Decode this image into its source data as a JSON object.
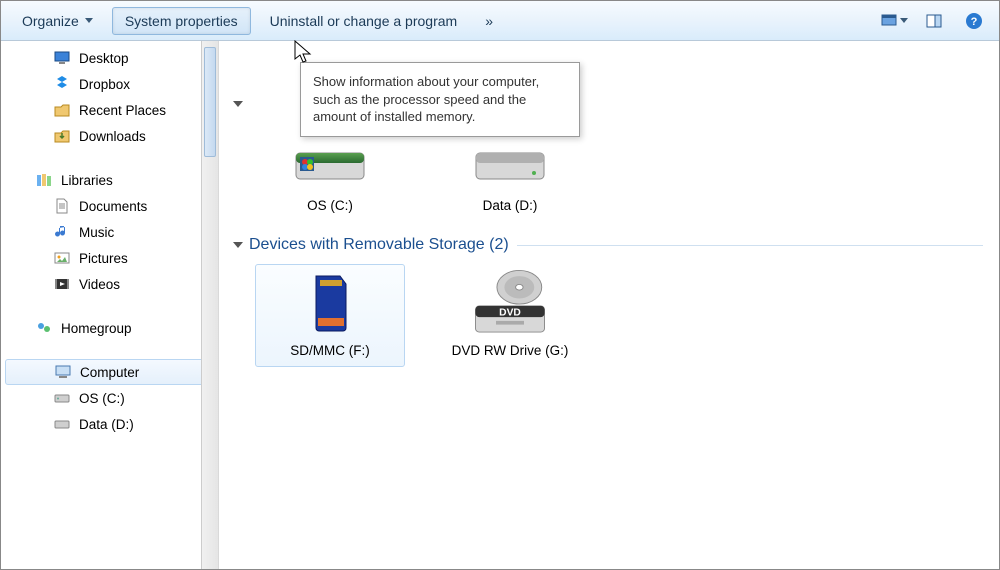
{
  "toolbar": {
    "organize": "Organize",
    "system_properties": "System properties",
    "uninstall": "Uninstall or change a program",
    "overflow": "»"
  },
  "tooltip": "Show information about your computer, such as the processor speed and the amount of installed memory.",
  "sidebar": {
    "favorites": [
      {
        "label": "Desktop",
        "icon": "desktop-icon"
      },
      {
        "label": "Dropbox",
        "icon": "dropbox-icon"
      },
      {
        "label": "Recent Places",
        "icon": "recent-icon"
      },
      {
        "label": "Downloads",
        "icon": "downloads-icon"
      }
    ],
    "libraries_label": "Libraries",
    "libraries": [
      {
        "label": "Documents",
        "icon": "documents-icon"
      },
      {
        "label": "Music",
        "icon": "music-icon"
      },
      {
        "label": "Pictures",
        "icon": "pictures-icon"
      },
      {
        "label": "Videos",
        "icon": "videos-icon"
      }
    ],
    "homegroup_label": "Homegroup",
    "computer_label": "Computer",
    "computer_children": [
      {
        "label": "OS (C:)",
        "icon": "drive-c-icon"
      },
      {
        "label": "Data (D:)",
        "icon": "drive-d-icon"
      }
    ]
  },
  "content": {
    "drives_top": [
      {
        "label": "OS (C:)"
      },
      {
        "label": "Data (D:)"
      }
    ],
    "removable_header": "Devices with Removable Storage (2)",
    "drives_removable": [
      {
        "label": "SD/MMC (F:)"
      },
      {
        "label": "DVD RW Drive (G:)"
      }
    ]
  }
}
